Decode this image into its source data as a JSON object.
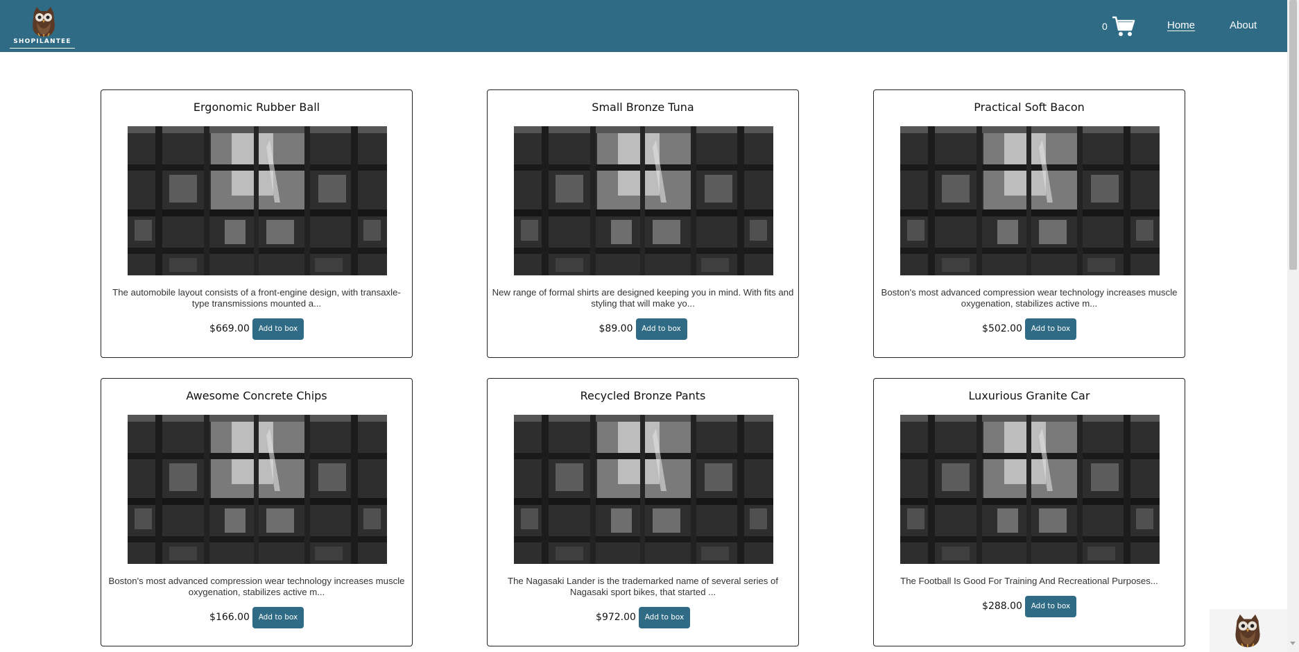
{
  "header": {
    "logo_text": "SHOPILANTEE",
    "cart_count": "0",
    "nav": {
      "home": "Home",
      "about": "About"
    }
  },
  "products": [
    {
      "title": "Ergonomic Rubber Ball",
      "description": "The automobile layout consists of a front-engine design, with transaxle-type transmissions mounted a...",
      "price": "$669.00",
      "button": "Add to box"
    },
    {
      "title": "Small Bronze Tuna",
      "description": "New range of formal shirts are designed keeping you in mind. With fits and styling that will make yo...",
      "price": "$89.00",
      "button": "Add to box"
    },
    {
      "title": "Practical Soft Bacon",
      "description": "Boston's most advanced compression wear technology increases muscle oxygenation, stabilizes active m...",
      "price": "$502.00",
      "button": "Add to box"
    },
    {
      "title": "Awesome Concrete Chips",
      "description": "Boston's most advanced compression wear technology increases muscle oxygenation, stabilizes active m...",
      "price": "$166.00",
      "button": "Add to box"
    },
    {
      "title": "Recycled Bronze Pants",
      "description": "The Nagasaki Lander is the trademarked name of several series of Nagasaki sport bikes, that started ...",
      "price": "$972.00",
      "button": "Add to box"
    },
    {
      "title": "Luxurious Granite Car",
      "description": "The Football Is Good For Training And Recreational Purposes...",
      "price": "$288.00",
      "button": "Add to box"
    }
  ],
  "colors": {
    "brand": "#306b86",
    "background": "#ffffff",
    "card_border": "#222222"
  },
  "icons": {
    "cart": "shopping-cart-icon",
    "logo": "owl-logo-icon",
    "widget": "owl-widget-icon"
  }
}
